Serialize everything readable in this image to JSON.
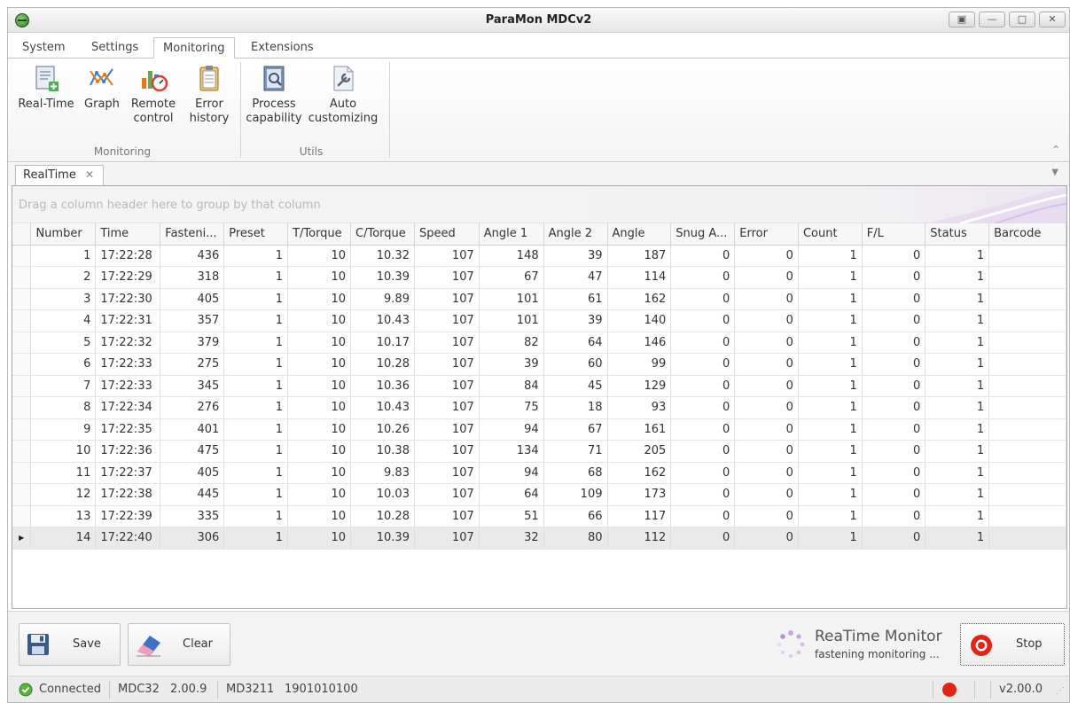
{
  "window": {
    "title": "ParaMon MDCv2"
  },
  "ribbon_tabs": [
    "System",
    "Settings",
    "Monitoring",
    "Extensions"
  ],
  "ribbon": {
    "monitoring_group": {
      "label": "Monitoring",
      "buttons": [
        {
          "label_line1": "Real-Time",
          "label_line2": ""
        },
        {
          "label_line1": "Graph",
          "label_line2": ""
        },
        {
          "label_line1": "Remote",
          "label_line2": "control"
        },
        {
          "label_line1": "Error",
          "label_line2": "history"
        }
      ]
    },
    "utils_group": {
      "label": "Utils",
      "buttons": [
        {
          "label_line1": "Process",
          "label_line2": "capability"
        },
        {
          "label_line1": "Auto",
          "label_line2": "customizing"
        }
      ]
    }
  },
  "document_tab": {
    "label": "RealTime",
    "close": "✕"
  },
  "grid": {
    "group_hint": "Drag a column header here to group by that column",
    "columns": [
      "Number",
      "Time",
      "Fasteni...",
      "Preset",
      "T/Torque",
      "C/Torque",
      "Speed",
      "Angle 1",
      "Angle 2",
      "Angle",
      "Snug A...",
      "Error",
      "Count",
      "F/L",
      "Status",
      "Barcode"
    ],
    "rows": [
      [
        "1",
        "17:22:28",
        "436",
        "1",
        "10",
        "10.32",
        "107",
        "148",
        "39",
        "187",
        "0",
        "0",
        "1",
        "0",
        "1",
        ""
      ],
      [
        "2",
        "17:22:29",
        "318",
        "1",
        "10",
        "10.39",
        "107",
        "67",
        "47",
        "114",
        "0",
        "0",
        "1",
        "0",
        "1",
        ""
      ],
      [
        "3",
        "17:22:30",
        "405",
        "1",
        "10",
        "9.89",
        "107",
        "101",
        "61",
        "162",
        "0",
        "0",
        "1",
        "0",
        "1",
        ""
      ],
      [
        "4",
        "17:22:31",
        "357",
        "1",
        "10",
        "10.43",
        "107",
        "101",
        "39",
        "140",
        "0",
        "0",
        "1",
        "0",
        "1",
        ""
      ],
      [
        "5",
        "17:22:32",
        "379",
        "1",
        "10",
        "10.17",
        "107",
        "82",
        "64",
        "146",
        "0",
        "0",
        "1",
        "0",
        "1",
        ""
      ],
      [
        "6",
        "17:22:33",
        "275",
        "1",
        "10",
        "10.28",
        "107",
        "39",
        "60",
        "99",
        "0",
        "0",
        "1",
        "0",
        "1",
        ""
      ],
      [
        "7",
        "17:22:33",
        "345",
        "1",
        "10",
        "10.36",
        "107",
        "84",
        "45",
        "129",
        "0",
        "0",
        "1",
        "0",
        "1",
        ""
      ],
      [
        "8",
        "17:22:34",
        "276",
        "1",
        "10",
        "10.43",
        "107",
        "75",
        "18",
        "93",
        "0",
        "0",
        "1",
        "0",
        "1",
        ""
      ],
      [
        "9",
        "17:22:35",
        "401",
        "1",
        "10",
        "10.26",
        "107",
        "94",
        "67",
        "161",
        "0",
        "0",
        "1",
        "0",
        "1",
        ""
      ],
      [
        "10",
        "17:22:36",
        "475",
        "1",
        "10",
        "10.38",
        "107",
        "134",
        "71",
        "205",
        "0",
        "0",
        "1",
        "0",
        "1",
        ""
      ],
      [
        "11",
        "17:22:37",
        "405",
        "1",
        "10",
        "9.83",
        "107",
        "94",
        "68",
        "162",
        "0",
        "0",
        "1",
        "0",
        "1",
        ""
      ],
      [
        "12",
        "17:22:38",
        "445",
        "1",
        "10",
        "10.03",
        "107",
        "64",
        "109",
        "173",
        "0",
        "0",
        "1",
        "0",
        "1",
        ""
      ],
      [
        "13",
        "17:22:39",
        "335",
        "1",
        "10",
        "10.28",
        "107",
        "51",
        "66",
        "117",
        "0",
        "0",
        "1",
        "0",
        "1",
        ""
      ],
      [
        "14",
        "17:22:40",
        "306",
        "1",
        "10",
        "10.39",
        "107",
        "32",
        "80",
        "112",
        "0",
        "0",
        "1",
        "0",
        "1",
        ""
      ]
    ],
    "focused_row_marker": "▶"
  },
  "bottom": {
    "save_label": "Save",
    "clear_label": "Clear",
    "monitor_title": "ReaTime Monitor",
    "monitor_sub": "fastening monitoring ...",
    "stop_label": "Stop"
  },
  "status": {
    "connection": "Connected",
    "model": "MDC32",
    "fw": "2.00.9",
    "device": "MD3211",
    "serial": "1901010100",
    "version": "v2.00.0"
  },
  "colors": {
    "accent_purple": "#c7a8dc",
    "status_red": "#e02418",
    "ok_green": "#5bb33a"
  }
}
